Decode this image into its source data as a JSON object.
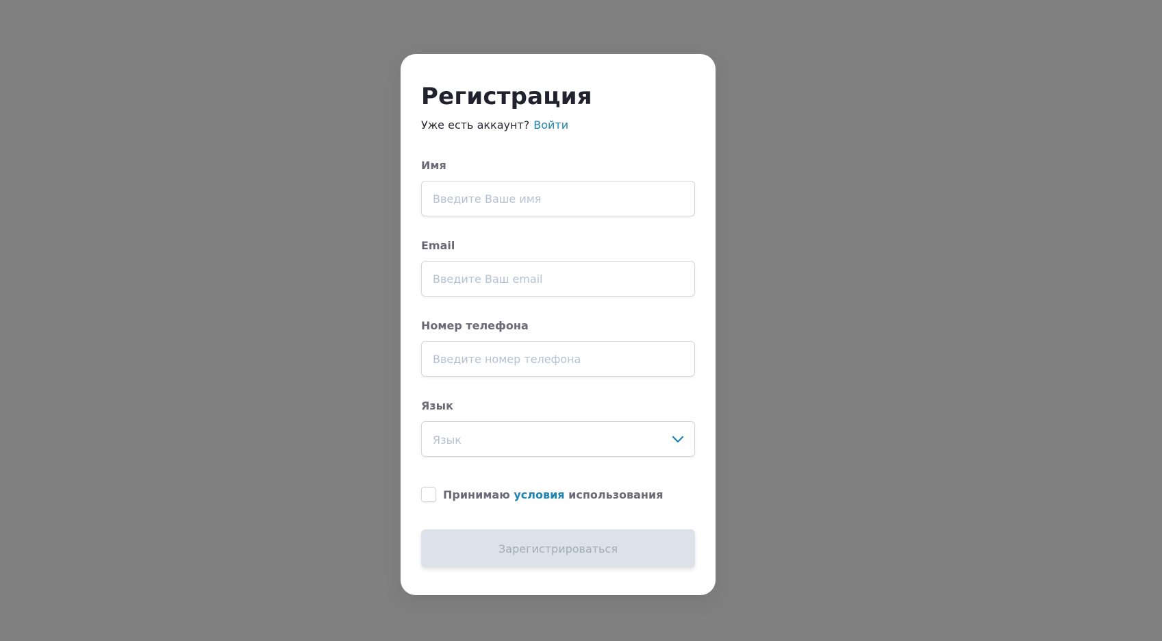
{
  "form": {
    "title": "Регистрация",
    "subtitle": "Уже есть аккаунт?",
    "login_link": "Войти",
    "fields": {
      "name": {
        "label": "Имя",
        "placeholder": "Введите Ваше имя"
      },
      "email": {
        "label": "Email",
        "placeholder": "Введите Ваш email"
      },
      "phone": {
        "label": "Номер телефона",
        "placeholder": "Введите номер телефона"
      },
      "language": {
        "label": "Язык",
        "placeholder": "Язык",
        "icon": "chevron-down-icon"
      }
    },
    "terms": {
      "prefix": "Принимаю",
      "link": "условия",
      "suffix": "использования",
      "checked": false
    },
    "submit_label": "Зарегистрироваться",
    "submit_disabled": true
  },
  "colors": {
    "backdrop": "#808080",
    "card": "#ffffff",
    "accent": "#1f86b3",
    "button_disabled_bg": "#dde2ea",
    "button_disabled_text": "#a3acb9"
  }
}
